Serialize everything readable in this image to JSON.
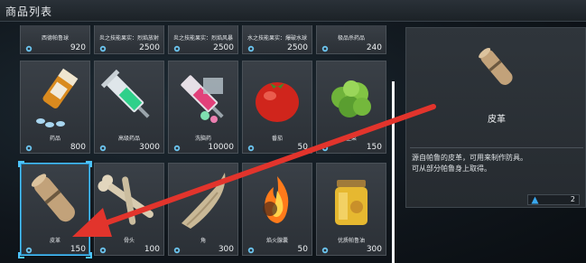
{
  "header": {
    "title": "商品列表"
  },
  "colors": {
    "accent": "#4cc3ff",
    "arrow": "#e2342c"
  },
  "row1": [
    {
      "name": "西德帕鲁球",
      "price": "920"
    },
    {
      "name": "炎之技能果实：烈焰放射",
      "price": "2500"
    },
    {
      "name": "炎之技能果实：烈焰风暴",
      "price": "2500"
    },
    {
      "name": "水之技能果实：爆破水球",
      "price": "2500"
    },
    {
      "name": "极品杀药品",
      "price": "240"
    }
  ],
  "row2": [
    {
      "name": "药品",
      "price": "800",
      "icon": "medicine-icon"
    },
    {
      "name": "高级药品",
      "price": "3000",
      "icon": "syringe-icon"
    },
    {
      "name": "洗脑药",
      "price": "10000",
      "icon": "brainwash-icon"
    },
    {
      "name": "番茄",
      "price": "50",
      "icon": "tomato-icon"
    },
    {
      "name": "生菜",
      "price": "150",
      "icon": "lettuce-icon"
    }
  ],
  "row3": [
    {
      "name": "皮革",
      "price": "150",
      "icon": "leather-icon"
    },
    {
      "name": "骨头",
      "price": "100",
      "icon": "bone-icon"
    },
    {
      "name": "角",
      "price": "300",
      "icon": "horn-icon"
    },
    {
      "name": "焰火腺囊",
      "price": "50",
      "icon": "flame-organ-icon"
    },
    {
      "name": "优质帕鲁油",
      "price": "300",
      "icon": "pal-oil-icon"
    }
  ],
  "detail": {
    "name": "皮革",
    "description_line1": "源自帕鲁的皮革，可用来制作防具。",
    "description_line2": "可从部分帕鲁身上取得。",
    "quantity": "2"
  }
}
